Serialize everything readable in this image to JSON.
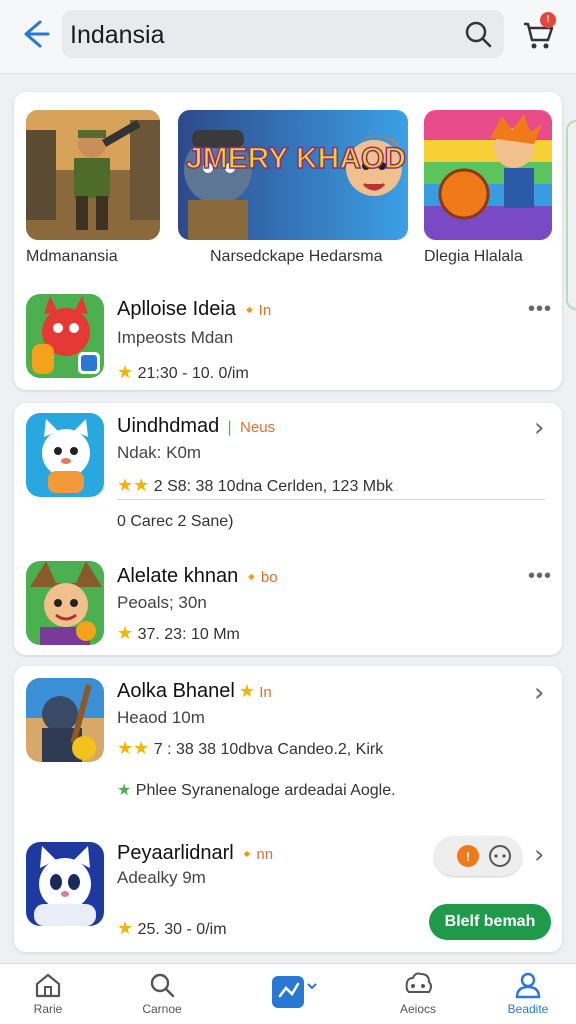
{
  "search": {
    "query": "Indansia"
  },
  "header": {
    "cart_badge": "!"
  },
  "featured": [
    {
      "label": "Mdmanansia"
    },
    {
      "label": "Narsedckape Hedarsma",
      "art_text": "JMERY KHAOD"
    },
    {
      "label": "Dlegia Hlalala"
    }
  ],
  "apps": [
    {
      "name": "Aplloise Ideia",
      "tag": "In",
      "subtitle": "Impeosts Mdan",
      "meta": "21:30 - 10. 0/im",
      "stars": "★"
    },
    {
      "name": "Uindhdmad",
      "tag": "Neus",
      "subtitle": "Ndak: K0m",
      "meta": "2 S8: 38 10dna Cerlden, 123 Mbk",
      "stars": "★★",
      "note": "0 Carec 2 Sane)"
    },
    {
      "name": "Alelate khnan",
      "tag": "bo",
      "subtitle": "Peoals; 30n",
      "meta": "37. 23: 10 Mm",
      "stars": "★"
    },
    {
      "name": "Aolka Bhanel",
      "tag": "In",
      "subtitle": "Heaod 10m",
      "meta": "7 : 38 38 10dbva Candeo.2, Kirk",
      "stars": "★★",
      "note": "Phlee   Syranenaloge   ardeadai Aogle."
    },
    {
      "name": "Peyaarlidnarl",
      "tag": "nn",
      "subtitle": "Adealky 9m",
      "meta": "25. 30 -   0/im",
      "stars": "★"
    }
  ],
  "get_button": "Blelf bemah",
  "nav": [
    {
      "label": "Rarie"
    },
    {
      "label": "Carnoe"
    },
    {
      "label": ""
    },
    {
      "label": "Aeiocs"
    },
    {
      "label": "Beadite"
    }
  ],
  "colors": {
    "accent": "#2a78d6",
    "get_button": "#1e9a4a",
    "badge": "#e5483a",
    "star": "#f4b400"
  }
}
